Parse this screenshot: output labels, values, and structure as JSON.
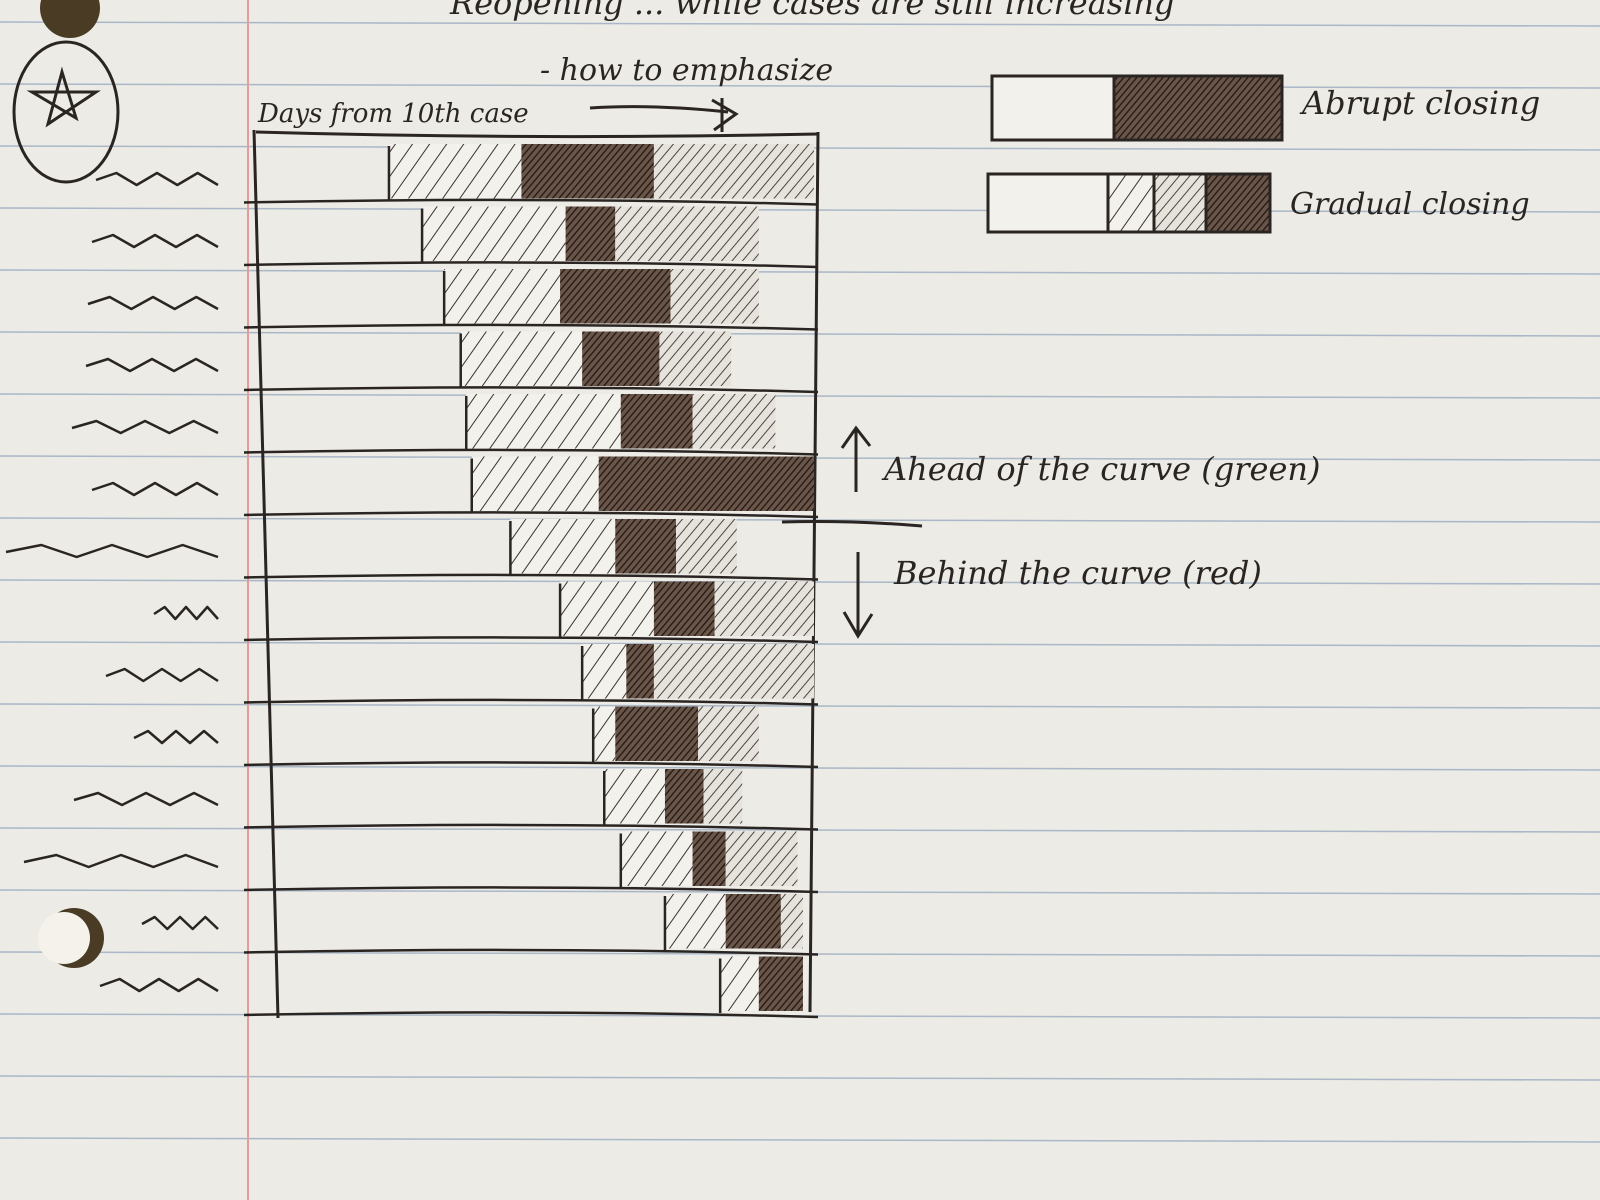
{
  "page": {
    "header_line_1": "Reopening ... while cases are still increasing",
    "header_line_2": "- how to emphasize"
  },
  "chart": {
    "axis_label": "Days from 10th case",
    "ahead_label": "Ahead of the curve (green)",
    "behind_label": "Behind the curve (red)"
  },
  "legend": {
    "abrupt_label": "Abrupt closing",
    "gradual_label": "Gradual closing"
  },
  "chart_data": {
    "type": "bar",
    "orientation": "horizontal-timeline",
    "rows": [
      {
        "start": 0.23,
        "light_end": 0.47,
        "dark_end": 0.71,
        "end": 1.0
      },
      {
        "start": 0.29,
        "light_end": 0.55,
        "dark_end": 0.64,
        "end": 0.9
      },
      {
        "start": 0.33,
        "light_end": 0.54,
        "dark_end": 0.74,
        "end": 0.9
      },
      {
        "start": 0.36,
        "light_end": 0.58,
        "dark_end": 0.72,
        "end": 0.85
      },
      {
        "start": 0.37,
        "light_end": 0.65,
        "dark_end": 0.78,
        "end": 0.93
      },
      {
        "start": 0.38,
        "light_end": 0.61,
        "dark_end": 1.0,
        "end": 1.0
      },
      {
        "start": 0.45,
        "light_end": 0.64,
        "dark_end": 0.75,
        "end": 0.86
      },
      {
        "start": 0.54,
        "light_end": 0.71,
        "dark_end": 0.82,
        "end": 1.0
      },
      {
        "start": 0.58,
        "light_end": 0.66,
        "dark_end": 0.71,
        "end": 1.0
      },
      {
        "start": 0.6,
        "light_end": 0.64,
        "dark_end": 0.79,
        "end": 0.9
      },
      {
        "start": 0.62,
        "light_end": 0.73,
        "dark_end": 0.8,
        "end": 0.87
      },
      {
        "start": 0.65,
        "light_end": 0.78,
        "dark_end": 0.84,
        "end": 0.97
      },
      {
        "start": 0.73,
        "light_end": 0.84,
        "dark_end": 0.94,
        "end": 0.98
      },
      {
        "start": 0.83,
        "light_end": 0.9,
        "dark_end": 0.98,
        "end": 0.98
      }
    ]
  }
}
